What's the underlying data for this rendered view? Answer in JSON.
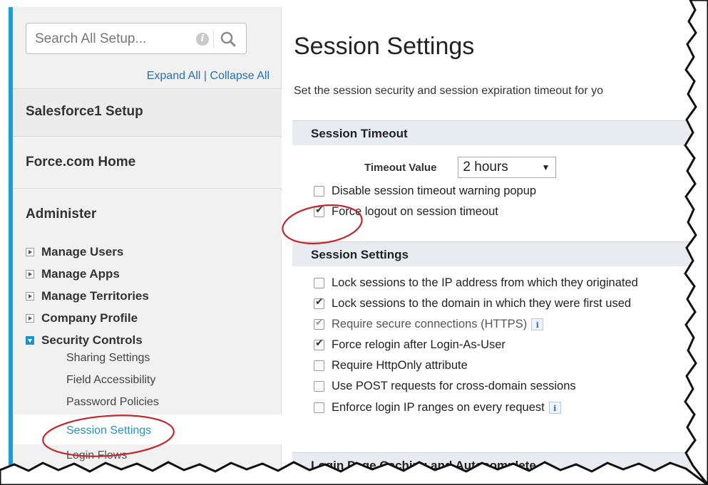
{
  "sidebar": {
    "search": {
      "placeholder": "Search All Setup..."
    },
    "expand_all": "Expand All",
    "separator": "|",
    "collapse_all": "Collapse All",
    "sections": [
      "Salesforce1 Setup",
      "Force.com Home",
      "Administer"
    ],
    "tree": [
      {
        "label": "Manage Users",
        "expanded": false
      },
      {
        "label": "Manage Apps",
        "expanded": false
      },
      {
        "label": "Manage Territories",
        "expanded": false
      },
      {
        "label": "Company Profile",
        "expanded": false
      },
      {
        "label": "Security Controls",
        "expanded": true
      }
    ],
    "sub_items": [
      "Sharing Settings",
      "Field Accessibility",
      "Password Policies",
      "Session Settings",
      "Login Flows"
    ],
    "selected": "Session Settings"
  },
  "main": {
    "title": "Session Settings",
    "description": "Set the session security and session expiration timeout for yo",
    "timeout_panel": {
      "heading": "Session Timeout",
      "timeout_label": "Timeout Value",
      "timeout_value": "2 hours",
      "options": [
        {
          "label": "Disable session timeout warning popup",
          "checked": false
        },
        {
          "label": "Force logout on session timeout",
          "checked": true
        }
      ]
    },
    "settings_panel": {
      "heading": "Session Settings",
      "options": [
        {
          "label": "Lock sessions to the IP address from which they originated",
          "checked": false
        },
        {
          "label": "Lock sessions to the domain in which they were first used",
          "checked": true
        },
        {
          "label": "Require secure connections (HTTPS)",
          "checked": true,
          "disabled": true,
          "info": true
        },
        {
          "label": "Force relogin after Login-As-User",
          "checked": true
        },
        {
          "label": "Require HttpOnly attribute",
          "checked": false
        },
        {
          "label": "Use POST requests for cross-domain sessions",
          "checked": false
        },
        {
          "label": "Enforce login IP ranges on every request",
          "checked": false,
          "info": true
        }
      ]
    },
    "caching_panel": {
      "heading": "Login Page Caching and Autocomplete"
    }
  },
  "colors": {
    "accent": "#1aa0d6",
    "link": "#2a6fb0",
    "annotation": "#c0282d"
  },
  "icons": {
    "search": "magnifier-icon",
    "help": "info-icon"
  }
}
